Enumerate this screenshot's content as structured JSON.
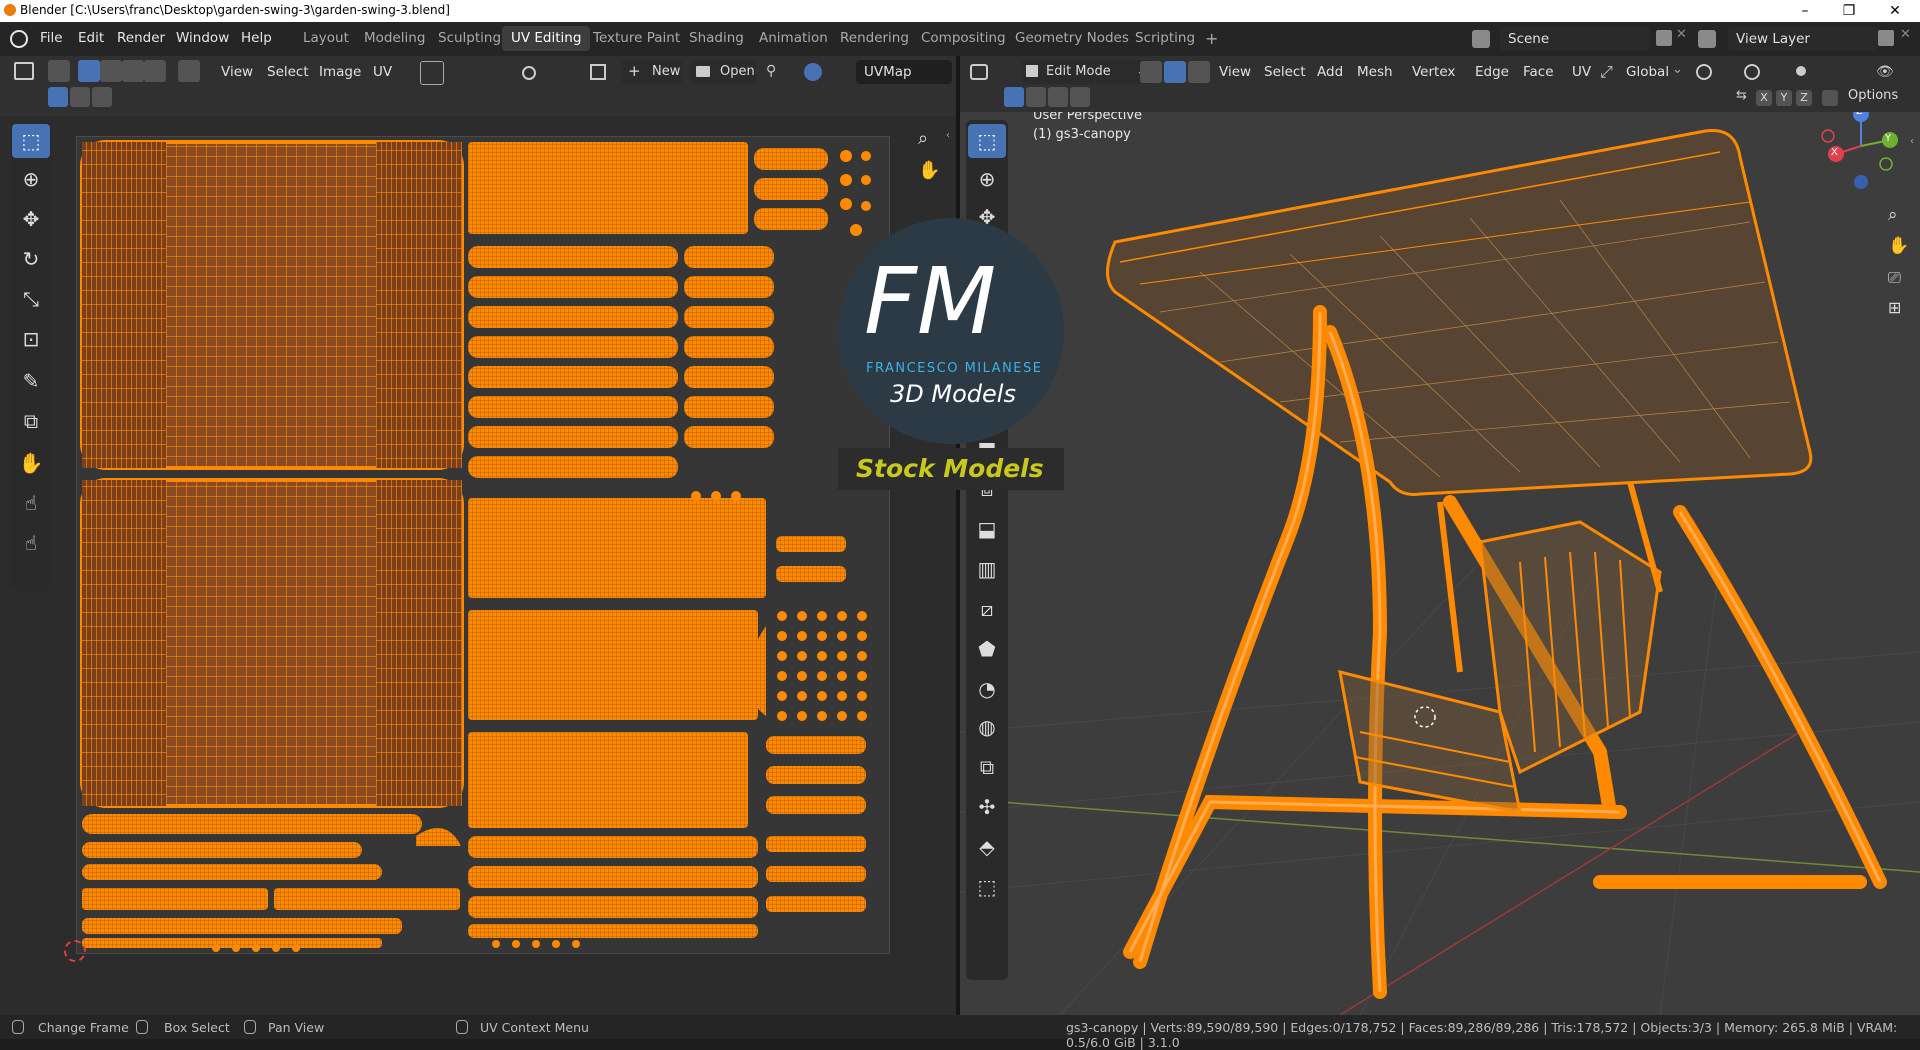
{
  "window": {
    "title": "Blender [C:\\Users\\franc\\Desktop\\garden-swing-3\\garden-swing-3.blend]",
    "controls": [
      "–",
      "❐",
      "✕"
    ]
  },
  "menubar": {
    "items": [
      "File",
      "Edit",
      "Render",
      "Window",
      "Help"
    ]
  },
  "workspaces": {
    "tabs": [
      "Layout",
      "Modeling",
      "Sculpting",
      "UV Editing",
      "Texture Paint",
      "Shading",
      "Animation",
      "Rendering",
      "Compositing",
      "Geometry Nodes",
      "Scripting"
    ],
    "active": "UV Editing",
    "add": "+"
  },
  "scene": {
    "label": "Scene"
  },
  "view_layer": {
    "label": "View Layer"
  },
  "uv_editor": {
    "menus": [
      "View",
      "Select",
      "Image",
      "UV"
    ],
    "new_label": "New",
    "open_label": "Open",
    "uvmap": "UVMap"
  },
  "viewport": {
    "mode": "Edit Mode",
    "menus": [
      "View",
      "Select",
      "Add",
      "Mesh",
      "Vertex",
      "Edge",
      "Face",
      "UV"
    ],
    "orientation": "Global",
    "axes": [
      "X",
      "Y",
      "Z"
    ],
    "options_label": "Options",
    "perspective": "User Perspective",
    "object": "(1) gs3-canopy",
    "gizmo": {
      "x": "X",
      "y": "Y",
      "z": "Z"
    }
  },
  "watermark": {
    "initials": "FM",
    "name": "FRANCESCO MILANESE",
    "tagline": "3D Models",
    "banner": "Stock Models"
  },
  "statusbar": {
    "change_frame": "Change Frame",
    "box_select": "Box Select",
    "pan_view": "Pan View",
    "context_menu": "UV Context Menu",
    "stats": "gs3-canopy | Verts:89,590/89,590 | Edges:0/178,752 | Faces:89,286/89,286 | Tris:178,572 | Objects:3/3 | Memory: 265.8 MiB | VRAM: 0.5/6.0 GiB | 3.1.0"
  },
  "colors": {
    "selection_orange": "#ff8a00",
    "uv_fill": "#8a4a22",
    "active_blue": "#4772b3",
    "editor_bg": "#303030",
    "viewport_bg": "#3d3d3d",
    "banner_yellow": "#c8c81e"
  }
}
